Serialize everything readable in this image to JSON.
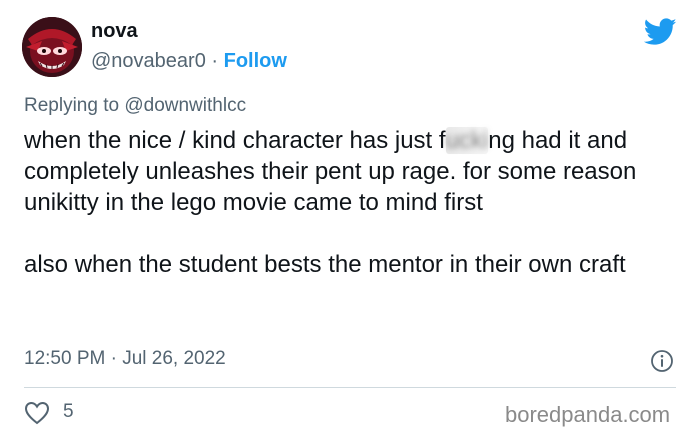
{
  "user": {
    "display_name": "nova",
    "handle": "@novabear0",
    "separator": "·",
    "follow_label": "Follow",
    "avatar_icon": "avatar-image"
  },
  "header": {
    "logo_icon": "twitter-bird-icon"
  },
  "reply": {
    "prefix": "Replying to",
    "mention": "@downwithlcc"
  },
  "tweet": {
    "para1_before": "when the nice / kind character has just f",
    "para1_censored": "ucki",
    "para1_after": "ng had it and completely unleashes their pent up rage. for some reason unikitty in the lego movie came to mind first",
    "para2": "also when the student bests the mentor in their own craft"
  },
  "meta": {
    "timestamp": "12:50 PM · Jul 26, 2022",
    "info_icon": "info-icon"
  },
  "actions": {
    "like_icon": "heart-icon",
    "like_count": "5"
  },
  "watermark": "boredpanda.com",
  "colors": {
    "accent": "#1d9bf0",
    "text": "#0f1419",
    "muted": "#536471",
    "divider": "#cfd9de"
  }
}
